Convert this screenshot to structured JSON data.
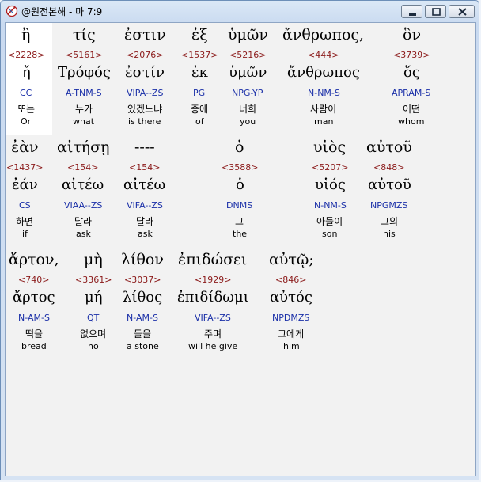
{
  "window": {
    "title": "@원전본해 - 마 7:9"
  },
  "rows": [
    {
      "words": [
        {
          "src": "ἢ",
          "num": "<2228>",
          "lex": "ἤ",
          "pars": "CC",
          "kor": "또는",
          "eng": "Or"
        },
        {
          "src": "τίς",
          "num": "<5161>",
          "lex": "Τρόφός",
          "pars": "A-TNM-S",
          "kor": "누가",
          "eng": "what"
        },
        {
          "src": "ἐστιν",
          "num": "<2076>",
          "lex": "ἐστίν",
          "pars": "VIPA--ZS",
          "kor": "있겠느냐",
          "eng": "is there"
        },
        {
          "src": "ἐξ",
          "num": "<1537>",
          "lex": "ἐκ",
          "pars": "PG",
          "kor": "중에",
          "eng": "of"
        },
        {
          "src": "ὑμῶν",
          "num": "<5216>",
          "lex": "ὑμῶν",
          "pars": "NPG-YP",
          "kor": "너희",
          "eng": "you"
        },
        {
          "src": "ἄνθρωπος,",
          "num": "<444>",
          "lex": "ἄνθρωπος",
          "pars": "N-NM-S",
          "kor": "사람이",
          "eng": "man"
        },
        {
          "src": "ὃν",
          "num": "<3739>",
          "lex": "ὅς",
          "pars": "APRAM-S",
          "kor": "어떤",
          "eng": "whom"
        }
      ]
    },
    {
      "words": [
        {
          "src": "ἐὰν",
          "num": "<1437>",
          "lex": "ἐάν",
          "pars": "CS",
          "kor": "하면",
          "eng": "if"
        },
        {
          "src": "αἰτήσῃ",
          "num": "<154>",
          "lex": "αἰτέω",
          "pars": "VIAA--ZS",
          "kor": "달라",
          "eng": "ask"
        },
        {
          "src": "----",
          "num": "<154>",
          "lex": "αἰτέω",
          "pars": "VIFA--ZS",
          "kor": "달라",
          "eng": "ask"
        },
        {
          "src": "ὁ",
          "num": "<3588>",
          "lex": "ὁ",
          "pars": "DNMS",
          "kor": "그",
          "eng": "the"
        },
        {
          "src": "υἱὸς",
          "num": "<5207>",
          "lex": "υἱός",
          "pars": "N-NM-S",
          "kor": "아들이",
          "eng": "son"
        },
        {
          "src": "αὐτοῦ",
          "num": "<848>",
          "lex": "αὐτοῦ",
          "pars": "NPGMZS",
          "kor": "그의",
          "eng": "his"
        }
      ]
    },
    {
      "words": [
        {
          "src": "ἄρτον,",
          "num": "<740>",
          "lex": "ἄρτος",
          "pars": "N-AM-S",
          "kor": "떡을",
          "eng": "bread"
        },
        {
          "src": "μὴ",
          "num": "<3361>",
          "lex": "μή",
          "pars": "QT",
          "kor": "없으며",
          "eng": "no"
        },
        {
          "src": "λίθον",
          "num": "<3037>",
          "lex": "λίθος",
          "pars": "N-AM-S",
          "kor": "돌을",
          "eng": "a stone"
        },
        {
          "src": "ἐπιδώσει",
          "num": "<1929>",
          "lex": "ἐπιδίδωμι",
          "pars": "VIFA--ZS",
          "kor": "주며",
          "eng": "will he give"
        },
        {
          "src": "αὐτῷ;",
          "num": "<846>",
          "lex": "αὐτός",
          "pars": "NPDMZS",
          "kor": "그에게",
          "eng": "him"
        }
      ]
    }
  ]
}
